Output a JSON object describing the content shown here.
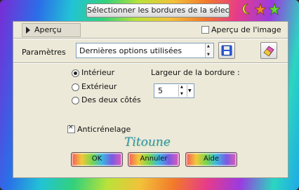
{
  "window": {
    "title": "Sélectionner les bordures de la sélection"
  },
  "preview": {
    "toggle_label": "Aperçu",
    "image_preview_label": "Aperçu de l'image",
    "image_preview_checked": false
  },
  "params": {
    "label": "Paramètres",
    "preset_value": "Dernières options utilisées"
  },
  "position": {
    "options": [
      "Intérieur",
      "Extérieur",
      "Des deux côtés"
    ],
    "selected": "Intérieur"
  },
  "border": {
    "label": "Largeur de la bordure :",
    "value": "5"
  },
  "antialias": {
    "label": "Anticrénelage",
    "checked": true
  },
  "watermark": {
    "text": "Titoune"
  },
  "buttons": {
    "ok": "OK",
    "cancel": "Annuler",
    "help": "Aide"
  },
  "icons": {
    "window_icons": [
      "moon-icon",
      "star-icon",
      "star-icon"
    ],
    "save_icon": "floppy-disk-icon",
    "reset_icon": "eraser-icon"
  }
}
